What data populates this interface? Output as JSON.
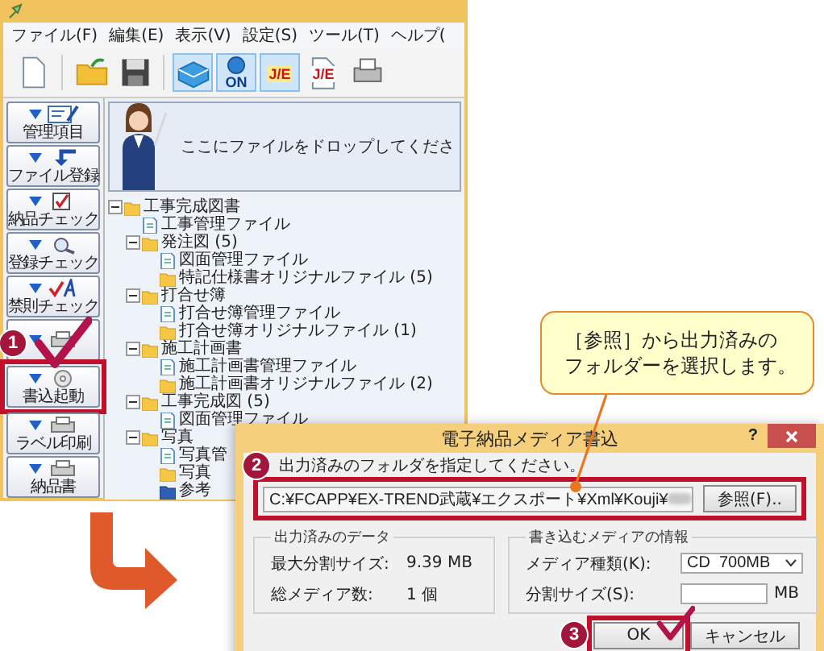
{
  "app_window": {
    "menu": [
      "ファイル(F)",
      "編集(E)",
      "表示(V)",
      "設定(S)",
      "ツール(T)",
      "ヘルプ("
    ],
    "toolbar": [
      {
        "kind": "new",
        "pressed": false
      },
      {
        "kind": "open",
        "pressed": false
      },
      {
        "kind": "save",
        "pressed": false
      },
      {
        "kind": "drive",
        "pressed": true
      },
      {
        "kind": "on",
        "pressed": true,
        "text": "ON"
      },
      {
        "kind": "je",
        "pressed": true,
        "text": "J/E"
      },
      {
        "kind": "je-doc",
        "pressed": false,
        "text": "J/E"
      },
      {
        "kind": "printer",
        "pressed": false
      }
    ],
    "drop_hint": "ここにファイルをドロップしてくださ",
    "side_buttons": [
      {
        "kind": "manage",
        "label": "管理項目",
        "highlighted": false
      },
      {
        "kind": "register",
        "label": "ファイル登録",
        "highlighted": false
      },
      {
        "kind": "deliver-check",
        "label": "納品チェック",
        "highlighted": false
      },
      {
        "kind": "register-check",
        "label": "登録チェック",
        "highlighted": false
      },
      {
        "kind": "rule-check",
        "label": "禁則チェック",
        "highlighted": false
      },
      {
        "kind": "navi",
        "highlighted": false
      },
      {
        "kind": "write",
        "label": "書込起動",
        "highlighted": true,
        "step": "1"
      },
      {
        "kind": "label",
        "label": "ラベル印刷",
        "highlighted": false
      },
      {
        "kind": "slip",
        "label": "納品書",
        "highlighted": false
      }
    ],
    "tree": [
      {
        "label": "工事完成図書",
        "kind": "folder",
        "expanded": true,
        "children": [
          {
            "label": "工事管理ファイル",
            "kind": "file"
          },
          {
            "label": "発注図 (5)",
            "kind": "folder",
            "expanded": true,
            "children": [
              {
                "label": "図面管理ファイル",
                "kind": "file"
              },
              {
                "label": "特記仕様書オリジナルファイル (5)",
                "kind": "folder"
              }
            ]
          },
          {
            "label": "打合せ簿",
            "kind": "folder",
            "expanded": true,
            "children": [
              {
                "label": "打合せ簿管理ファイル",
                "kind": "file"
              },
              {
                "label": "打合せ簿オリジナルファイル (1)",
                "kind": "folder"
              }
            ]
          },
          {
            "label": "施工計画書",
            "kind": "folder",
            "expanded": true,
            "children": [
              {
                "label": "施工計画書管理ファイル",
                "kind": "file"
              },
              {
                "label": "施工計画書オリジナルファイル (2)",
                "kind": "folder"
              }
            ]
          },
          {
            "label": "工事完成図 (5)",
            "kind": "folder",
            "expanded": true,
            "children": [
              {
                "label": "図面管理ファイル",
                "kind": "file"
              }
            ]
          },
          {
            "label": "写真",
            "kind": "folder",
            "expanded": true,
            "children": [
              {
                "label": "写真管",
                "kind": "file"
              },
              {
                "label": "写真",
                "kind": "folder"
              },
              {
                "label": "参考",
                "kind": "folder-blue"
              }
            ]
          }
        ]
      }
    ]
  },
  "callout": {
    "lines": [
      "［参照］から出力済みの",
      "フォルダーを選択します。"
    ]
  },
  "dialog": {
    "title": "電子納品メディア書込",
    "help": "?",
    "instruction": "出力済みのフォルダを指定してください。",
    "path": {
      "value": "C:¥FCAPP¥EX-TREND武蔵¥エクスポート¥Xml¥Kouji¥",
      "redacted": true,
      "highlighted": true,
      "step": "2"
    },
    "browse_button": "参照(F)..",
    "output_group": {
      "title": "出力済みのデータ",
      "rows": [
        {
          "label": "最大分割サイズ:",
          "value": "9.39 MB"
        },
        {
          "label": "総メディア数:",
          "value": "1 個"
        }
      ]
    },
    "media_group": {
      "title": "書き込むメディアの情報",
      "media_type": {
        "label": "メディア種類(K):",
        "value": "CD  700MB"
      },
      "split_size": {
        "label": "分割サイズ(S):",
        "unit": "MB"
      }
    },
    "buttons": [
      {
        "label": "OK",
        "highlighted": true,
        "step": "3"
      },
      {
        "label": "キャンセル",
        "highlighted": false
      }
    ]
  }
}
